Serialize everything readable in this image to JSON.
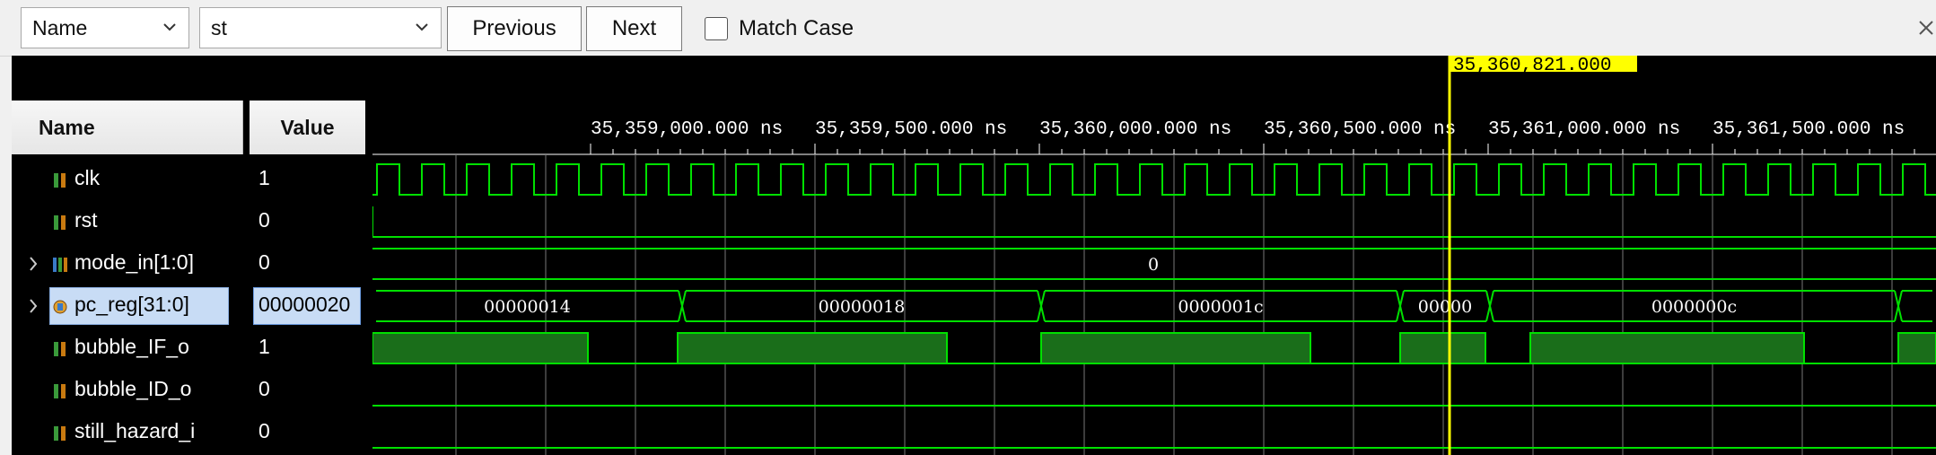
{
  "toolbar": {
    "search_field": "Name",
    "search_text": "st",
    "previous_label": "Previous",
    "next_label": "Next",
    "match_case_label": "Match Case"
  },
  "columns": {
    "name": "Name",
    "value": "Value"
  },
  "signals": [
    {
      "name": "clk",
      "value": "1",
      "icon": "scalar-signal-icon",
      "expandable": false
    },
    {
      "name": "rst",
      "value": "0",
      "icon": "scalar-signal-icon",
      "expandable": false
    },
    {
      "name": "mode_in[1:0]",
      "value": "0",
      "icon": "bus-signal-icon",
      "expandable": true
    },
    {
      "name": "pc_reg[31:0]",
      "value": "00000020",
      "icon": "register-bus-icon",
      "expandable": true,
      "selected": true
    },
    {
      "name": "bubble_IF_o",
      "value": "1",
      "icon": "scalar-signal-icon",
      "expandable": false
    },
    {
      "name": "bubble_ID_o",
      "value": "0",
      "icon": "scalar-signal-icon",
      "expandable": false
    },
    {
      "name": "still_hazard_i",
      "value": "0",
      "icon": "scalar-signal-icon",
      "expandable": false
    }
  ],
  "timeline": {
    "cursor_time": "35,360,821.000 ns",
    "ticks": [
      "35,359,000.000 ns",
      "35,359,500.000 ns",
      "35,360,000.000 ns",
      "35,360,500.000 ns",
      "35,361,000.000 ns",
      "35,361,500.000 ns"
    ]
  },
  "bus_values": {
    "mode_in": "0",
    "pc_reg": [
      "00000014",
      "00000018",
      "0000001c",
      "00000",
      "0000000c"
    ]
  },
  "colors": {
    "wave": "#00e000",
    "cursor": "#ffff00",
    "background": "#000000"
  }
}
